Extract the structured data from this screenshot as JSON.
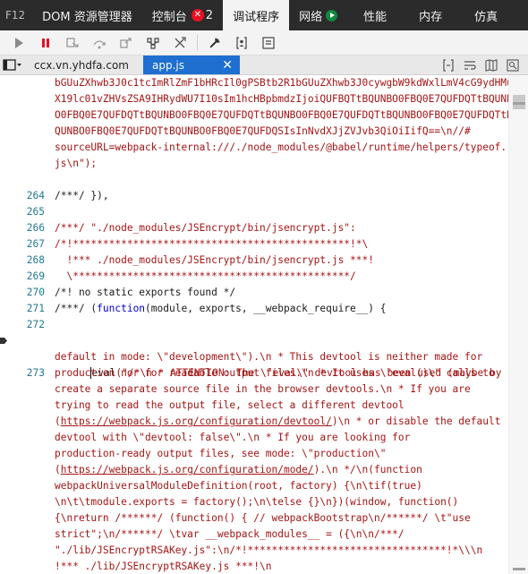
{
  "topbar": {
    "f12": "F12",
    "tabs": [
      "DOM 资源管理器",
      "控制台",
      "调试程序",
      "网络",
      "性能",
      "内存",
      "仿真"
    ],
    "error_count": "2",
    "error_badge_glyph": "✕",
    "active_tab": "调试程序"
  },
  "files": {
    "tab1": "ccx.vn.yhdfa.com",
    "tab2": "app.js",
    "close_glyph": "✕"
  },
  "code": {
    "wrap1": "bGUuZXhwb3J0c1tcImRlZmF1bHRcIl0gPSBtb2R1bGUuZXhwb3J0cywgbW9kdWxlLmV4cG9ydHMu",
    "wrap2": "X19lc01vZHVsZSA9IHRydWU7I10sIm1hcHBpbmdzIjoiQUFBQTtBQUNBO0FBQ0E7QUFDQTtBQUNB",
    "wrap3": "O0FBQ0E7QUFDQTtBQUNBO0FBQ0E7QUFDQTtBQUNBO0FBQ0E7QUFDQTtBQUNBO0FBQ0E7QUFDQTtB",
    "wrap4": "QUNBO0FBQ0E7QUFDQTtBQUNBO0FBQ0E7QUFDQSIsInNvdXJjZVJvb3QiOiIifQ==\\n//#",
    "wrap5": "sourceURL=webpack-internal:///./node_modules/@babel/runtime/helpers/typeof.",
    "wrap6": "js\\n\");",
    "l264": "/***/ }),",
    "l266": "/***/ \"./node_modules/JSEncrypt/bin/jsencrypt.js\":",
    "l267": "/*!**********************************************!*\\",
    "l268": "  !*** ./node_modules/JSEncrypt/bin/jsencrypt.js ***!",
    "l269": "  \\**********************************************/",
    "l270": "/*! no static exports found */",
    "l271_a": "/***/ (",
    "l271_kw": "function",
    "l271_b": "(module, exports, __webpack_require__) {",
    "l273_a": "eval",
    "l273_b": "(\"/*\\n * ATTENTION: The \\\"eval\\\" devtool has been used (maybe by",
    "w1": "default in mode: \\\"development\\\").\\n * This devtool is neither made for",
    "w2": "production nor for readable output files.\\n * It uses \\\"eval()\\\" calls to",
    "w3": "create a separate source file in the browser devtools.\\n * If you are",
    "w4": "trying to read the output file, select a different devtool",
    "w5_link": "https://webpack.js.org/configuration/devtool/",
    "w5_b": ")\\n * or disable the default",
    "w6": "devtool with \\\"devtool: false\\\".\\n * If you are looking for",
    "w7": "production-ready output files, see mode: \\\"production\\\"",
    "w8_link": "https://webpack.js.org/configuration/mode/",
    "w8_b": ").\\n */\\n(function",
    "w9": "webpackUniversalModuleDefinition(root, factory) {\\n\\tif(true)",
    "w10": "\\n\\t\\tmodule.exports = factory();\\n\\telse {}\\n})(window, function()",
    "w11": "{\\nreturn /******/ (function() { // webpackBootstrap\\n/******/ \\t\"use",
    "w12": "strict\";\\n/******/ \\tvar __webpack_modules__ = ({\\n\\n/***/",
    "w13": "\"./lib/JSEncryptRSAKey.js\":\\n/*!*********************************!*\\\\\\n",
    "w14": "!*** ./lib/JSEncryptRSAKey.js ***!\\n"
  },
  "line_numbers": {
    "n264": "264",
    "n265": "265",
    "n266": "266",
    "n267": "267",
    "n268": "268",
    "n269": "269",
    "n270": "270",
    "n271": "271",
    "n272": "272",
    "n273": "273"
  },
  "colors": {
    "topbar_bg": "#2b2b2b",
    "active_file_tab": "#1e6fd0",
    "string_red": "#a31515",
    "keyword_blue": "#0000cc",
    "line_number": "#237893",
    "error_badge": "#e81123",
    "network_badge": "#10893e",
    "pause_red": "#e81123"
  }
}
